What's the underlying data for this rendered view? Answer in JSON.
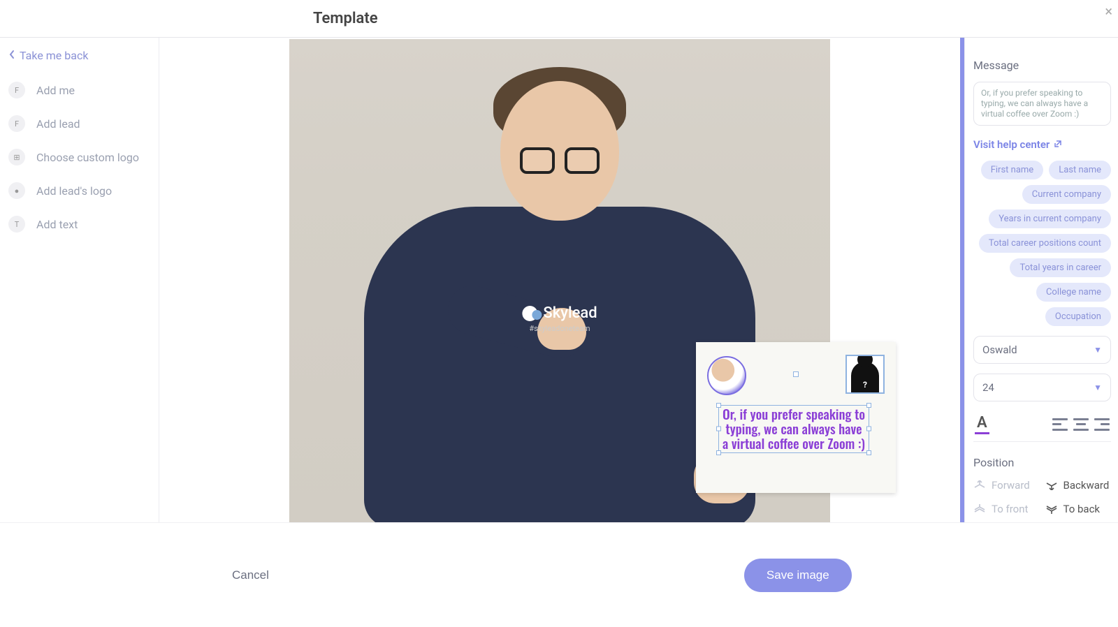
{
  "header": {
    "title": "Template"
  },
  "back": {
    "label": "Take me back"
  },
  "sidebar": {
    "items": [
      {
        "label": "Add me",
        "icon_letter": "F"
      },
      {
        "label": "Add lead",
        "icon_letter": "F"
      },
      {
        "label": "Choose custom logo",
        "icon_letter": "⊞"
      },
      {
        "label": "Add lead's logo",
        "icon_letter": "●"
      },
      {
        "label": "Add text",
        "icon_letter": "T"
      }
    ]
  },
  "canvas": {
    "logo_text": "Skylead",
    "logo_sub": "#skyleadoneteam",
    "text_overlay": "Or, if you prefer speaking to typing, we can always have a virtual coffee over Zoom :)"
  },
  "right": {
    "message_label": "Message",
    "message_value": "Or, if you prefer speaking to typing, we can always have a virtual coffee over Zoom :)",
    "help_link": "Visit help center",
    "chips": [
      "First name",
      "Last name",
      "Current company",
      "Years in current company",
      "Total career positions count",
      "Total years in career",
      "College name",
      "Occupation"
    ],
    "font_family": "Oswald",
    "font_size": "24",
    "position_label": "Position",
    "pos": {
      "forward": "Forward",
      "backward": "Backward",
      "to_front": "To front",
      "to_back": "To back"
    }
  },
  "footer": {
    "cancel": "Cancel",
    "save": "Save image"
  }
}
